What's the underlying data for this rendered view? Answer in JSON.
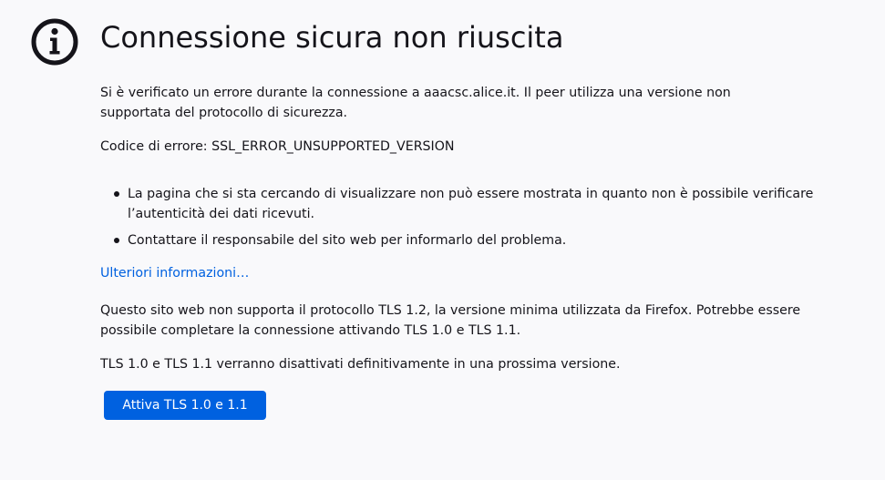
{
  "icon": "info-icon",
  "title": "Connessione sicura non riuscita",
  "description": "Si è verificato un errore durante la connessione a aaacsc.alice.it. Il peer utilizza una versione non supportata del protocollo di sicurezza.",
  "error_code": "Codice di errore: SSL_ERROR_UNSUPPORTED_VERSION",
  "bullets": [
    "La pagina che si sta cercando di visualizzare non può essere mostrata in quanto non è possibile verificare l’autenticità dei dati ricevuti.",
    "Contattare il responsabile del sito web per informarlo del problema."
  ],
  "learn_more": "Ulteriori informazioni…",
  "tls_notice": "Questo sito web non supporta il protocollo TLS 1.2, la versione minima utilizzata da Firefox. Potrebbe essere possibile completare la connessione attivando TLS 1.0 e TLS 1.1.",
  "tls_deprecation": "TLS 1.0 e TLS 1.1 verranno disattivati definitivamente in una prossima versione.",
  "enable_button": "Attiva TLS 1.0 e 1.1",
  "colors": {
    "background": "#f9f9fb",
    "text": "#15141a",
    "accent": "#0061e0"
  }
}
